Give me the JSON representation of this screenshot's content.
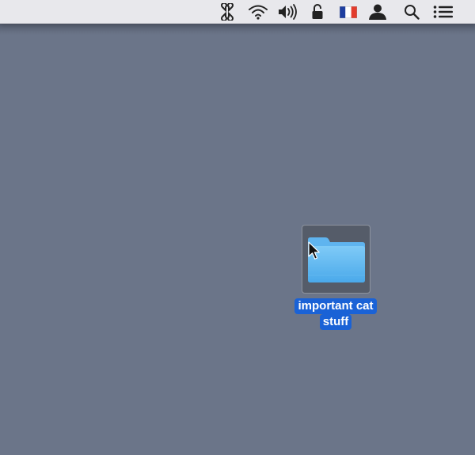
{
  "desktop": {
    "background_color": "#6b7589",
    "items": [
      {
        "type": "folder",
        "name_line1": "important cat",
        "name_line2": "stuff",
        "selected": true,
        "label_color": "#1a62d6",
        "folder_color": "#5ab8f2"
      }
    ]
  },
  "menubar": {
    "status_icons": [
      "pinwheel-icon",
      "wifi-icon",
      "volume-icon",
      "lock-icon",
      "french-flag-icon",
      "user-icon",
      "spotlight-search-icon",
      "notification-center-icon"
    ]
  },
  "cursor": {
    "icon": "arrow-pointer-icon"
  }
}
